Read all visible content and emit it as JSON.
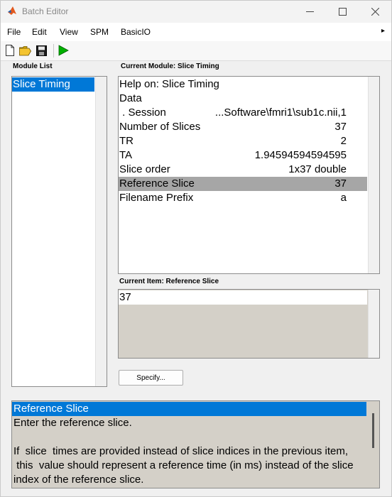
{
  "window": {
    "title": "Batch Editor",
    "min_glyph": "—",
    "max_glyph": "☐",
    "close_glyph": "✕"
  },
  "menu": {
    "items": [
      "File",
      "Edit",
      "View",
      "SPM",
      "BasicIO"
    ],
    "overflow_glyph": "▸"
  },
  "toolbar": {
    "icons": [
      "new-file-icon",
      "open-folder-icon",
      "save-icon",
      "run-icon"
    ],
    "run_color": "#00b000"
  },
  "module_list": {
    "label": "Module List",
    "items": [
      "Slice Timing"
    ]
  },
  "current_module": {
    "label": "Current Module: Slice Timing",
    "rows": [
      {
        "name": "Help on: Slice Timing",
        "value": ""
      },
      {
        "name": "Data",
        "value": ""
      },
      {
        "name": " . Session",
        "value": "...Software\\fmri1\\sub1c.nii,1"
      },
      {
        "name": "Number of Slices",
        "value": "37"
      },
      {
        "name": "TR",
        "value": "2"
      },
      {
        "name": "TA",
        "value": "1.94594594594595"
      },
      {
        "name": "Slice order",
        "value": "1x37 double"
      },
      {
        "name": "Reference Slice",
        "value": "37"
      },
      {
        "name": "Filename Prefix",
        "value": "a"
      }
    ],
    "highlighted_row": "Reference Slice"
  },
  "current_item": {
    "label": "Current Item: Reference Slice",
    "value": "37"
  },
  "specify_button": {
    "label": "Specify..."
  },
  "help": {
    "lines": [
      "Reference Slice",
      "Enter the reference slice.",
      "",
      "If  slice  times are provided instead of slice indices in the previous item,",
      " this  value should represent a reference time (in ms) instead of the slice",
      "index of the reference slice."
    ]
  },
  "colors": {
    "selection": "#0078d7",
    "row_highlight": "#a6a6a6",
    "readonly_bg": "#d4d0c8"
  }
}
